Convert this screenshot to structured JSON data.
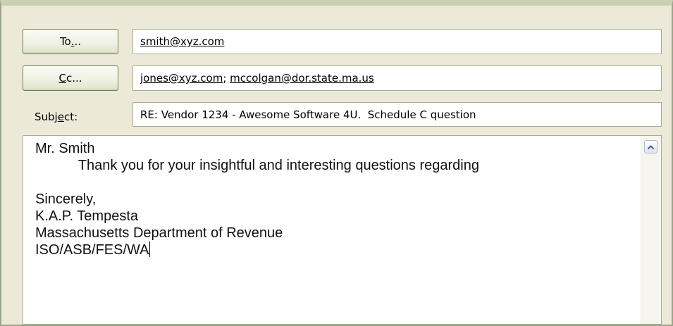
{
  "header": {
    "to_button": {
      "label_acc": "T",
      "label_rest": "o",
      "label_under": "...",
      "prefix": "To",
      "acc": ".",
      "suffix": ".."
    },
    "cc_button": {
      "acc": "C",
      "rest": "c..."
    },
    "to_value": "smith@xyz.com",
    "cc_values": [
      "jones@xyz.com",
      "mccolgan@dor.state.ma.us"
    ],
    "cc_separator": "; ",
    "subject_label_pre": "Subj",
    "subject_label_acc": "e",
    "subject_label_post": "ct:",
    "subject_value": "RE: Vendor 1234 - Awesome Software 4U.  Schedule C question"
  },
  "body": {
    "lines": [
      "Mr. Smith",
      "           Thank you for your insightful and interesting questions regarding",
      "",
      "Sincerely,",
      "K.A.P. Tempesta",
      "Massachusetts Department of Revenue",
      "ISO/ASB/FES/WA"
    ]
  },
  "icons": {
    "scroll_up": "chevron-up-icon"
  },
  "colors": {
    "chrome": "#ece9d8",
    "border": "#a5ae8d",
    "button_border": "#6f7a52"
  }
}
